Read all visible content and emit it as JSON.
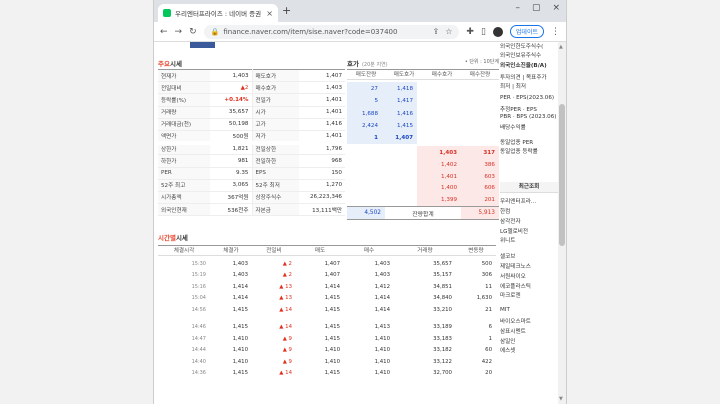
{
  "browser": {
    "tab_title": "우리엔터프라이즈 : 네이버 증권",
    "url": "finance.naver.com/item/sise.naver?code=037400",
    "update_label": "업데이트"
  },
  "left": {
    "title_pre": "주요",
    "title_post": "시세",
    "rows": [
      {
        "l1": "현재가",
        "v1": "1,403",
        "l2": "매도호가",
        "v2": "1,407"
      },
      {
        "l1": "전일대비",
        "v1": "▲2",
        "l2": "매수호가",
        "v2": "1,403"
      },
      {
        "l1": "등락률(%)",
        "v1": "+0.14%",
        "l2": "전일가",
        "v2": "1,401"
      },
      {
        "l1": "거래량",
        "v1": "35,657",
        "l2": "시가",
        "v2": "1,401"
      },
      {
        "l1": "거래대금(천)",
        "v1": "50,198",
        "l2": "고가",
        "v2": "1,416"
      },
      {
        "l1": "액면가",
        "v1": "500원",
        "l2": "저가",
        "v2": "1,401"
      },
      {
        "l1": "상한가",
        "v1": "1,821",
        "l2": "전일상한",
        "v2": "1,796"
      },
      {
        "l1": "하한가",
        "v1": "981",
        "l2": "전일하한",
        "v2": "968"
      },
      {
        "l1": "PER",
        "v1": "9.35",
        "l2": "EPS",
        "v2": "150"
      },
      {
        "l1": "52주 최고",
        "v1": "3,065",
        "l2": "52주 최저",
        "v2": "1,270"
      },
      {
        "l1": "시가총액",
        "v1": "367억원",
        "l2": "상장주식수",
        "v2": "26,223,346"
      },
      {
        "l1": "외국인현재",
        "v1": "536천주",
        "l2": "자본금",
        "v2": "13,111백만"
      }
    ]
  },
  "hoga": {
    "title": "호가",
    "sub": "(20분 지연)",
    "unit": "• 단위 : 10단계",
    "cols": [
      "매도잔량",
      "매도호가",
      "매수호가",
      "매수잔량"
    ],
    "asks": [
      {
        "qty": "27",
        "price": "1,418"
      },
      {
        "qty": "5",
        "price": "1,417"
      },
      {
        "qty": "1,688",
        "price": "1,416"
      },
      {
        "qty": "2,424",
        "price": "1,415"
      },
      {
        "qty": "1",
        "price": "1,407"
      }
    ],
    "bids": [
      {
        "price": "1,403",
        "qty": "317"
      },
      {
        "price": "1,402",
        "qty": "386"
      },
      {
        "price": "1,401",
        "qty": "603"
      },
      {
        "price": "1,400",
        "qty": "606"
      },
      {
        "price": "1,399",
        "qty": "201"
      }
    ],
    "total_ask": "4,502",
    "total_label": "잔량합계",
    "total_bid": "5,913"
  },
  "timeline": {
    "title_pre": "시간별",
    "title_post": "시세",
    "cols": [
      "체결시각",
      "체결가",
      "전일비",
      "매도",
      "매수",
      "거래량",
      "변동량"
    ],
    "rows": [
      {
        "t": "15:30",
        "p": "1,403",
        "d": "▲ 2",
        "s": "1,407",
        "b": "1,403",
        "v": "35,657",
        "c": "500"
      },
      {
        "t": "15:19",
        "p": "1,403",
        "d": "▲ 2",
        "s": "1,407",
        "b": "1,403",
        "v": "35,157",
        "c": "306"
      },
      {
        "t": "15:16",
        "p": "1,414",
        "d": "▲ 13",
        "s": "1,414",
        "b": "1,412",
        "v": "34,851",
        "c": "11"
      },
      {
        "t": "15:04",
        "p": "1,414",
        "d": "▲ 13",
        "s": "1,415",
        "b": "1,414",
        "v": "34,840",
        "c": "1,630"
      },
      {
        "t": "14:56",
        "p": "1,415",
        "d": "▲ 14",
        "s": "1,415",
        "b": "1,414",
        "v": "33,210",
        "c": "21"
      },
      {
        "t": "14:46",
        "p": "1,415",
        "d": "▲ 14",
        "s": "1,415",
        "b": "1,413",
        "v": "33,189",
        "c": "6"
      },
      {
        "t": "14:47",
        "p": "1,410",
        "d": "▲ 9",
        "s": "1,415",
        "b": "1,410",
        "v": "33,183",
        "c": "1"
      },
      {
        "t": "14:44",
        "p": "1,410",
        "d": "▲ 9",
        "s": "1,410",
        "b": "1,410",
        "v": "33,182",
        "c": "60"
      },
      {
        "t": "14:40",
        "p": "1,410",
        "d": "▲ 9",
        "s": "1,410",
        "b": "1,410",
        "v": "33,122",
        "c": "422"
      },
      {
        "t": "14:36",
        "p": "1,415",
        "d": "▲ 14",
        "s": "1,415",
        "b": "1,410",
        "v": "32,700",
        "c": "20"
      }
    ]
  },
  "right": {
    "top": [
      "외국인한도주식수(",
      "외국인보유주식수",
      "외국인소진율(B/A)"
    ],
    "mid": [
      "투자의견 | 목표주가",
      "최저 | 최저"
    ],
    "stats": [
      "PER · EPS(2023.06)",
      "추정PER · EPS",
      "PBR · BPS (2023.06)",
      "배당수익률"
    ],
    "sector": [
      "동일업종 PER",
      "동일업종 등락률"
    ],
    "recent_title": "최근조회",
    "recent": [
      "우리엔터프라...",
      "한컴",
      "삼각전자",
      "LG헬로비전",
      "위니트",
      "",
      "셀코브",
      "제일테크노스",
      "서원싸이오",
      "에코플라스틱",
      "마크로젠",
      "",
      "MIT",
      "바이오스마트",
      "삼표시멘트",
      "삼일인",
      "에스셋"
    ]
  }
}
